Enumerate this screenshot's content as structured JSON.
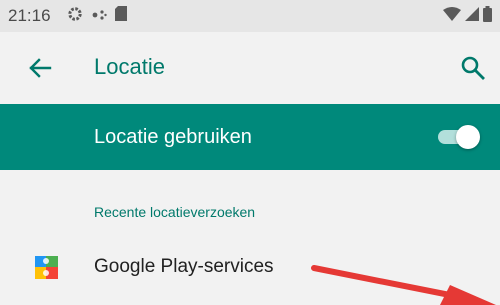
{
  "status_bar": {
    "time": "21:16",
    "left_icons": [
      "settings-icon",
      "dots-icon",
      "sd-card-icon"
    ],
    "right_icons": [
      "wifi-icon",
      "cell-signal-icon",
      "battery-icon"
    ]
  },
  "app_bar": {
    "back_icon": "arrow-back-icon",
    "title": "Locatie",
    "search_icon": "search-icon"
  },
  "use_location": {
    "label": "Locatie gebruiken",
    "enabled": true
  },
  "recent_requests": {
    "header": "Recente locatieverzoeken",
    "items": [
      {
        "icon": "google-play-services-icon",
        "label": "Google Play-services"
      }
    ]
  },
  "colors": {
    "accent": "#00796b",
    "header_bg": "#00897b",
    "background": "#f2f2f2",
    "annotation": "#e53935"
  }
}
